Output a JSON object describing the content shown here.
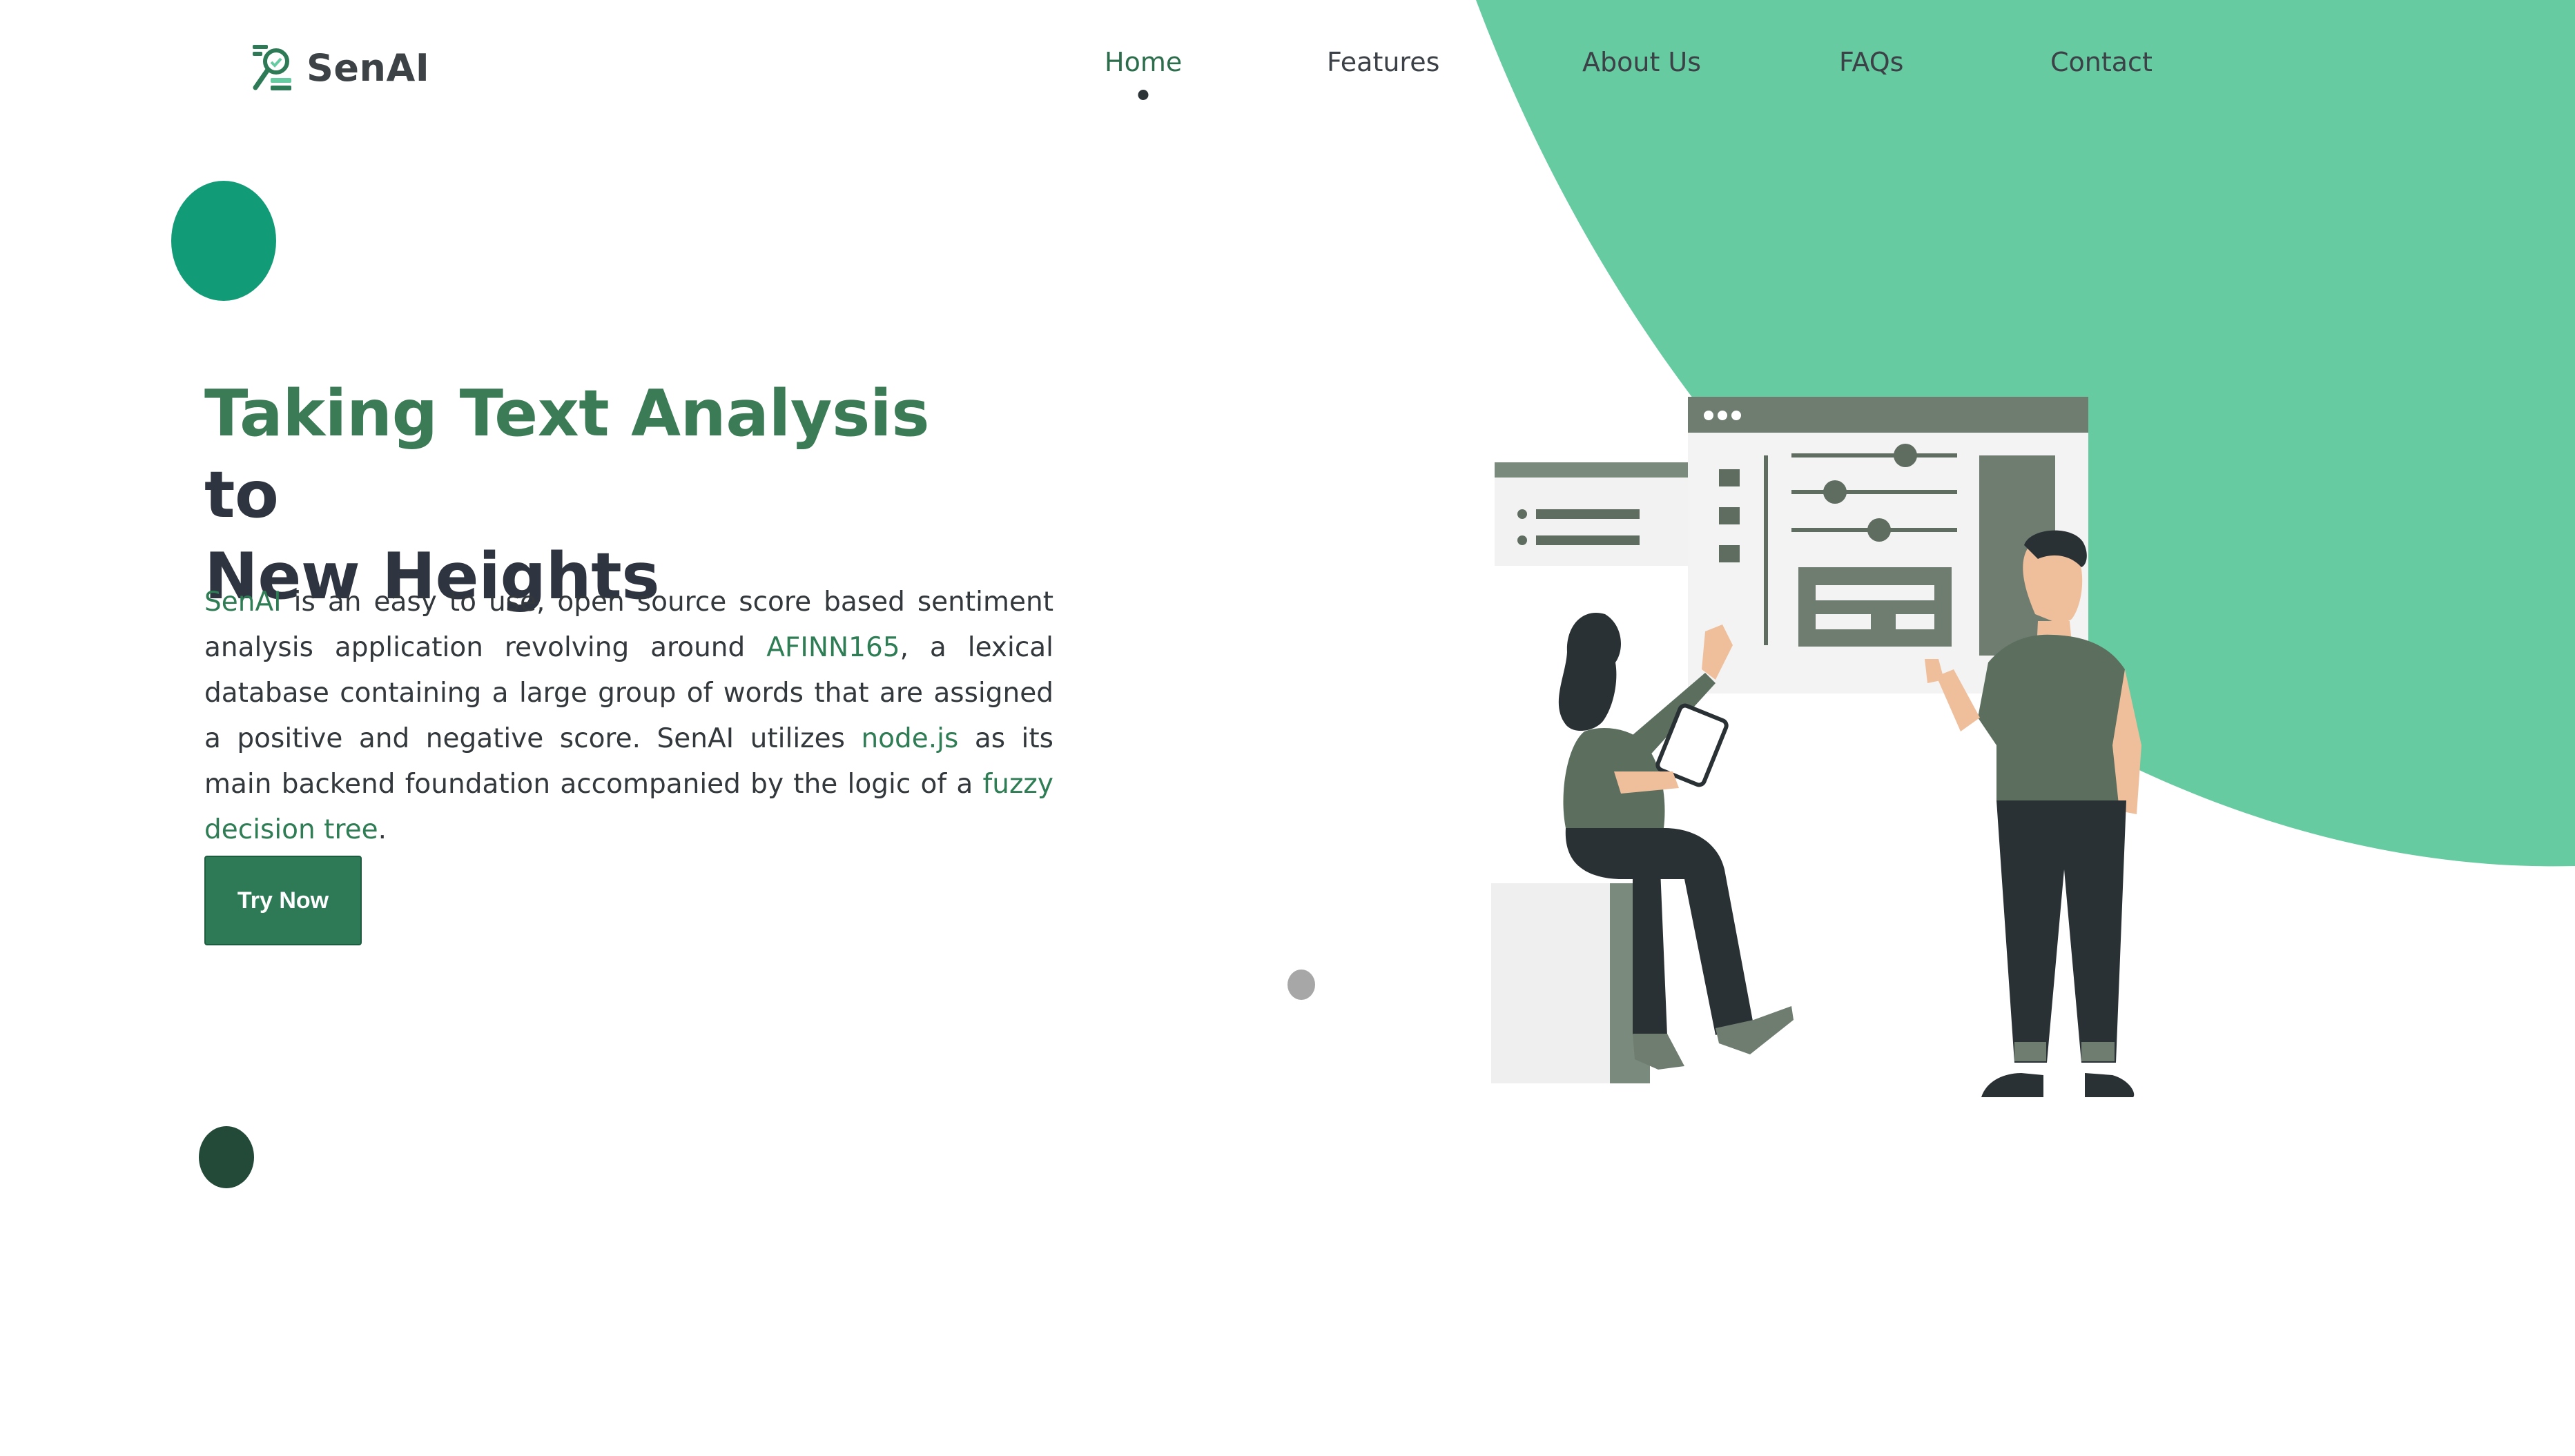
{
  "brand": {
    "name": "SenAI",
    "color": "#2e7a56"
  },
  "nav": {
    "items": [
      {
        "label": "Home",
        "active": true
      },
      {
        "label": "Features",
        "active": false
      },
      {
        "label": "About Us",
        "active": false
      },
      {
        "label": "FAQs",
        "active": false
      },
      {
        "label": "Contact",
        "active": false
      }
    ]
  },
  "hero": {
    "title_highlight": "Taking Text Analysis",
    "title_rest_1": "to",
    "title_rest_2": "New Heights",
    "desc": {
      "senai_link": "SenAI",
      "part1": " is an easy to use, open source score based sentiment analysis application revolving around ",
      "afinn_link": "AFINN165",
      "part2": ", a lexical database containing a large group of words that are assigned a positive and negative score. SenAI utilizes ",
      "node_link": "node.js",
      "part3": " as its main backend foundation accompanied by the logic of a ",
      "fuzzy_link": "fuzzy decision tree",
      "part4": "."
    },
    "cta_label": "Try Now"
  },
  "colors": {
    "accent_green": "#66cba0",
    "dark_green": "#2e7a56",
    "teal_dot": "#129b77",
    "forest_dot": "#234a38",
    "grey_dot": "#a7a7a7"
  },
  "icons": {
    "logo": "magnifier-chart-logo"
  }
}
